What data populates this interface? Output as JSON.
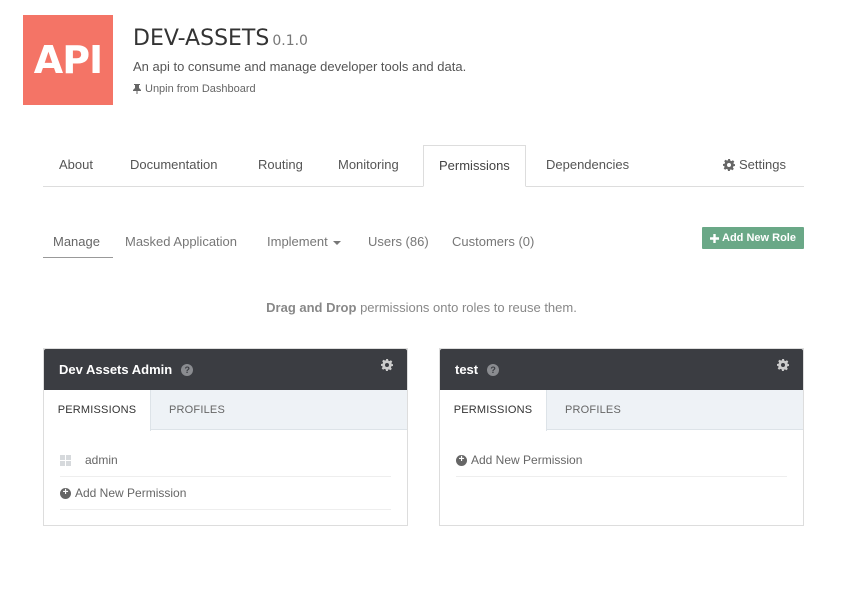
{
  "api": {
    "logo_text": "API",
    "name": "DEV-ASSETS",
    "version": "0.1.0",
    "description": "An api to consume and manage developer tools and data.",
    "unpin_label": "Unpin from Dashboard"
  },
  "main_tabs": {
    "about": "About",
    "documentation": "Documentation",
    "routing": "Routing",
    "monitoring": "Monitoring",
    "permissions": "Permissions",
    "dependencies": "Dependencies",
    "settings": "Settings",
    "active": "Permissions"
  },
  "subnav": {
    "manage": "Manage",
    "masked_application": "Masked Application",
    "implement": "Implement",
    "users": "Users (86)",
    "customers": "Customers (0)",
    "add_role": "Add New Role",
    "active": "Manage"
  },
  "hint": {
    "bold": "Drag and Drop",
    "rest": " permissions onto roles to reuse them."
  },
  "roles": [
    {
      "name": "Dev Assets Admin",
      "tab_permissions": "PERMISSIONS",
      "tab_profiles": "PROFILES",
      "permissions": [
        "admin"
      ],
      "add_permission": "Add New Permission"
    },
    {
      "name": "test",
      "tab_permissions": "PERMISSIONS",
      "tab_profiles": "PROFILES",
      "permissions": [],
      "add_permission": "Add New Permission"
    }
  ],
  "colors": {
    "logo_bg": "#f47466",
    "role_header_bg": "#3b3d42",
    "add_role_btn": "#6aa887"
  },
  "icons": [
    "pin-icon",
    "gear-icon",
    "plus-icon",
    "help-icon",
    "grid-icon",
    "plus-circle-icon",
    "caret-down-icon"
  ]
}
